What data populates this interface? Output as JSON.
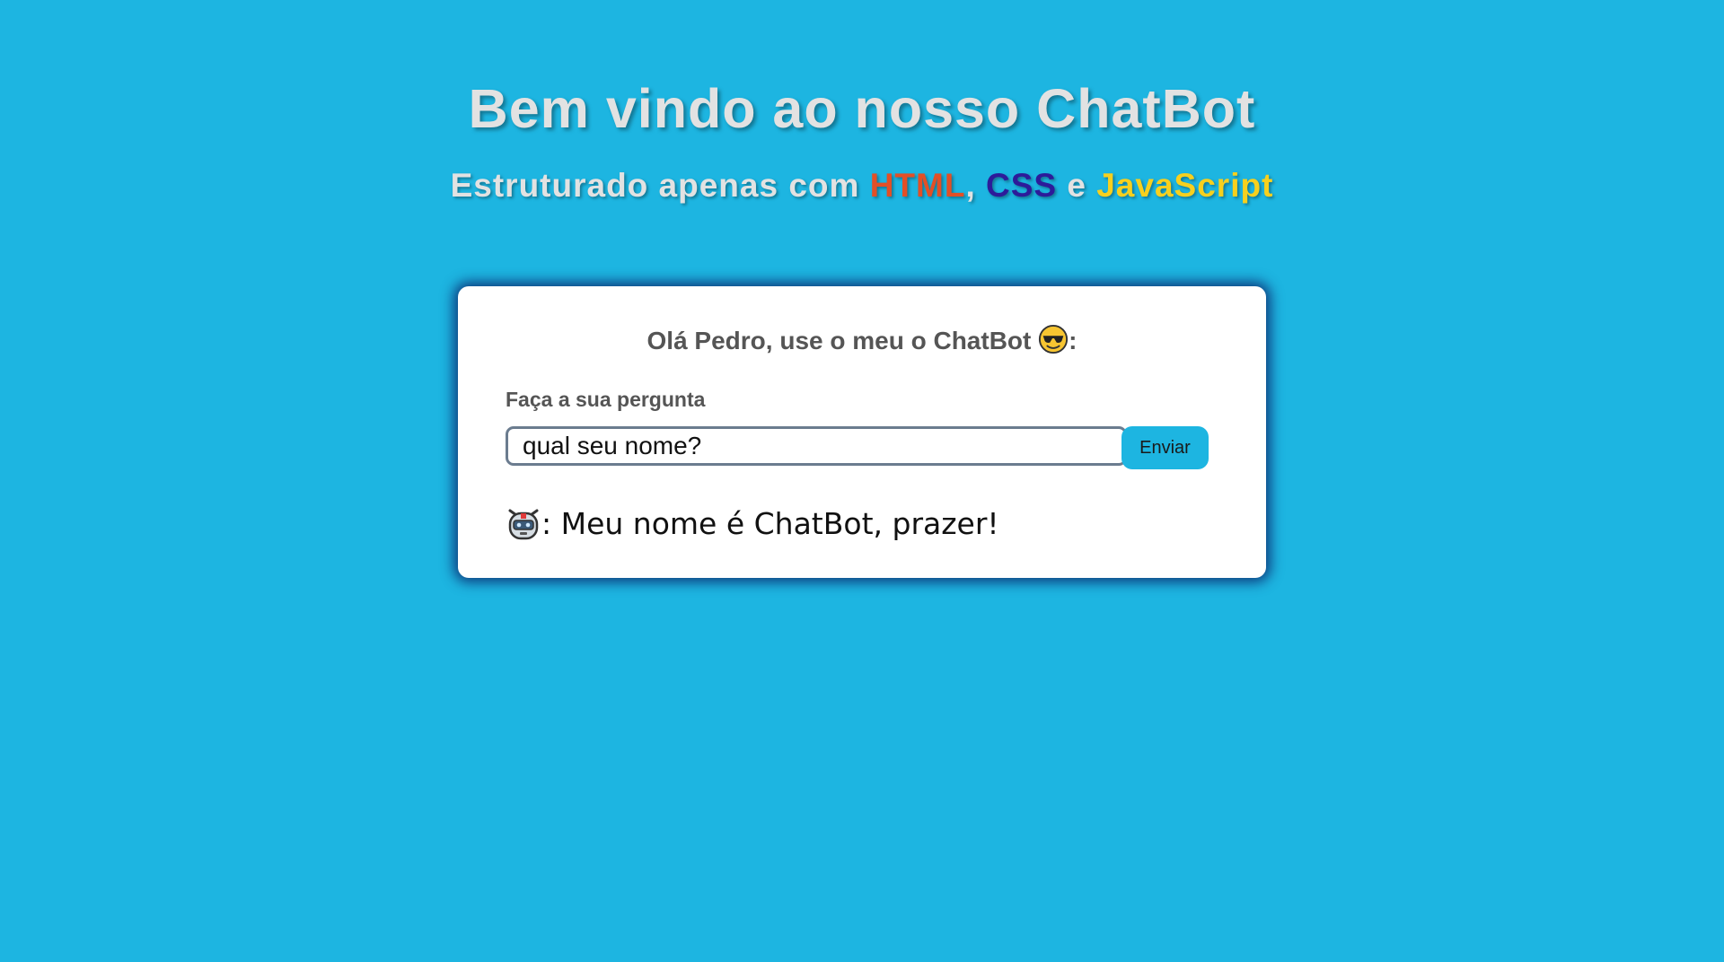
{
  "header": {
    "title": "Bem vindo ao nosso ChatBot",
    "subtitle_prefix": "Estruturado apenas com ",
    "subtitle_html": "HTML",
    "subtitle_sep1": ", ",
    "subtitle_css": "CSS",
    "subtitle_sep2": " e ",
    "subtitle_js": "JavaScript"
  },
  "card": {
    "greeting": "Olá Pedro, use o meu o ChatBot ",
    "greeting_suffix": ":",
    "ask_label": "Faça a sua pergunta",
    "question_value": "qual seu nome?",
    "send_label": "Enviar",
    "answer_sep": ": ",
    "answer_text": "Meu nome é ChatBot, prazer!"
  },
  "icons": {
    "greeting_emoji": "sunglasses-face-icon",
    "answer_emoji": "robot-face-icon"
  },
  "colors": {
    "background": "#1db5e1",
    "html": "#e34f26",
    "css": "#2d1b9a",
    "javascript": "#f7d01e",
    "card_shadow": "#0c286e"
  }
}
